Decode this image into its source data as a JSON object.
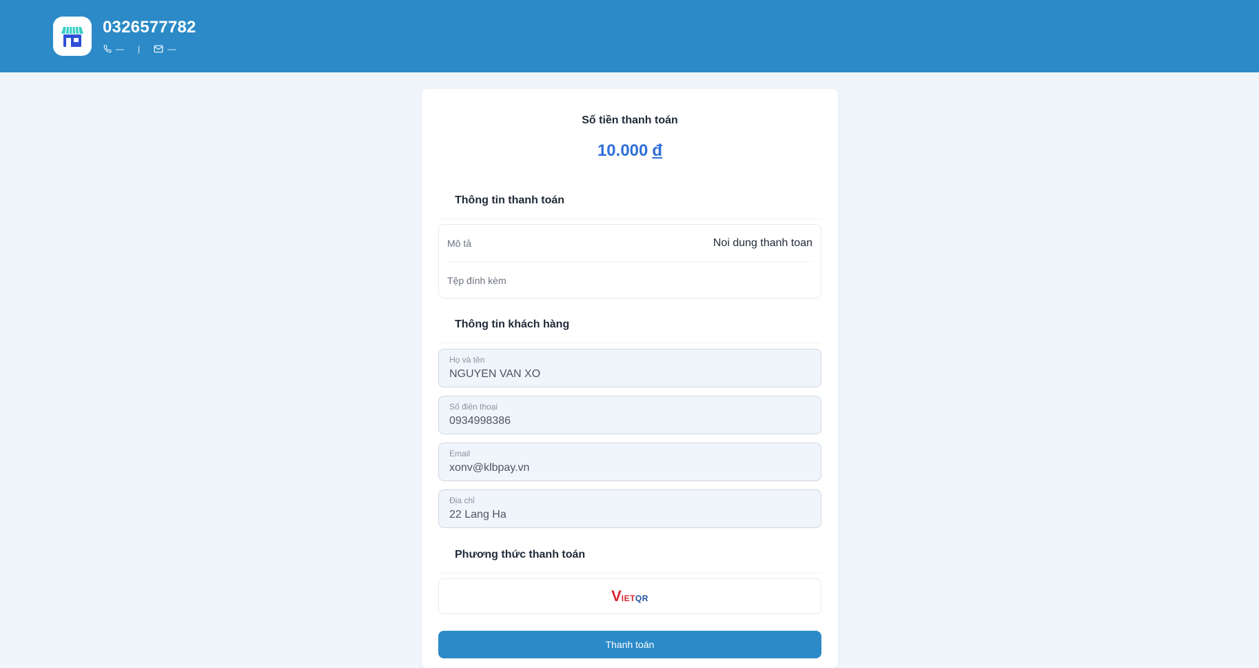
{
  "header": {
    "shop_name": "0326577782",
    "phone": "—",
    "separator": "|",
    "email": "—"
  },
  "payment": {
    "amount_label": "Số tiền thanh toán",
    "amount": "10.000",
    "currency": "đ"
  },
  "payment_info": {
    "title": "Thông tin thanh toán",
    "rows": [
      {
        "label": "Mô tả",
        "value": "Noi dung thanh toan"
      },
      {
        "label": "Tệp đính kèm",
        "value": ""
      }
    ]
  },
  "customer_info": {
    "title": "Thông tin khách hàng",
    "fields": [
      {
        "label": "Họ và tên",
        "value": "NGUYEN VAN XO"
      },
      {
        "label": "Số điện thoại",
        "value": "0934998386"
      },
      {
        "label": "Email",
        "value": "xonv@klbpay.vn"
      },
      {
        "label": "Địa chỉ",
        "value": "22 Lang Ha"
      }
    ]
  },
  "payment_method": {
    "title": "Phương thức thanh toán",
    "logo_text": [
      "V",
      "IET",
      "QR"
    ]
  },
  "actions": {
    "pay_label": "Thanh toán"
  },
  "colors": {
    "brand": "#2b8ac7",
    "amount": "#2f6fd8",
    "background": "#f0f5fc"
  }
}
